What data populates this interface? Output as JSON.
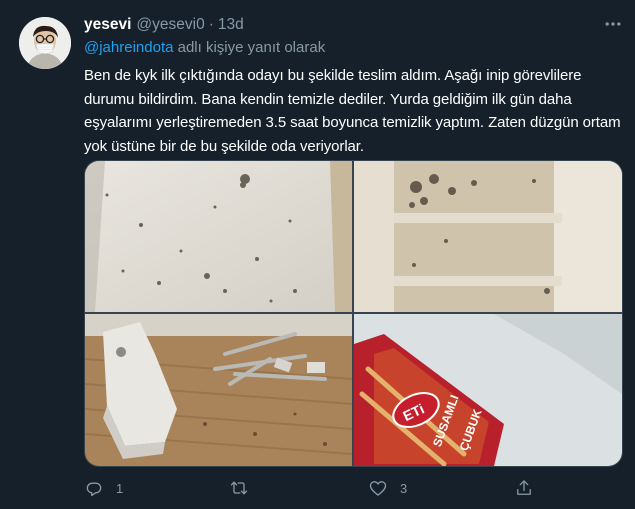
{
  "tweet": {
    "display_name": "yesevi",
    "handle": "@yesevi0",
    "separator": "·",
    "time": "13d",
    "reply_prefix": "",
    "reply_mention": "@jahreindota",
    "reply_suffix": " adlı kişiye yanıt olarak",
    "text": "Ben de kyk ilk çıktığında odayı bu şekilde teslim aldım. Aşağı inip görevlilere durumu bildirdim. Bana kendin temizle dediler. Yurda geldiğim ilk gün daha eşyalarımı yerleştiremeden 3.5 saat boyunca temizlik yaptım. Zaten düzgün ortam yok üstüne bir de bu şekilde oda veriyorlar.",
    "photos": [
      "stained-wall",
      "dirty-shelves",
      "dirty-desk-with-cutlery",
      "eti-susamli-cubuk-package"
    ],
    "package_brand": "ETi",
    "package_line1": "SUSAMLI",
    "package_line2": "ÇUBUK"
  },
  "actions": {
    "reply_count": "1",
    "retweet_count": "",
    "like_count": "3",
    "share_count": ""
  },
  "icons": {
    "more": "more-icon",
    "reply": "reply-icon",
    "retweet": "retweet-icon",
    "like": "heart-icon",
    "share": "share-icon"
  },
  "colors": {
    "background": "#15202b",
    "secondary_text": "#8899a6",
    "link": "#1da1f2"
  }
}
